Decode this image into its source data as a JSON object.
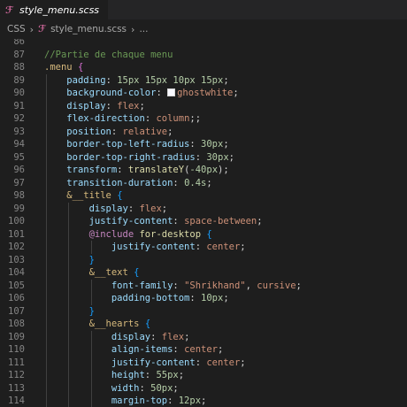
{
  "tab": {
    "label": "style_menu.scss",
    "icon": "sass-icon"
  },
  "breadcrumb": {
    "folder": "CSS",
    "file": "style_menu.scss",
    "more": "..."
  },
  "colors": {
    "editor_bg": "#1e1e1e",
    "comment": "#6a9955",
    "selector": "#d7ba7d",
    "property": "#9cdcfe",
    "string_value": "#ce9178",
    "number": "#b5cea8",
    "function": "#dcdcaa",
    "at_rule": "#c586c0",
    "brace_level1": "#da70d6",
    "brace_level2": "#179fff",
    "swatch_ghostwhite": "#f8f8ff"
  },
  "editor": {
    "lines": [
      {
        "n": "86",
        "tokens": []
      },
      {
        "n": "87",
        "tokens": [
          [
            "c-comment",
            "//Partie de chaque menu"
          ]
        ]
      },
      {
        "n": "88",
        "tokens": [
          [
            "c-sel",
            ".menu"
          ],
          [
            "c-punc",
            " "
          ],
          [
            "c-brace",
            "{"
          ]
        ]
      },
      {
        "n": "89",
        "tokens": [
          [
            "c-punc",
            "    "
          ],
          [
            "c-prop",
            "padding"
          ],
          [
            "c-punc",
            ": "
          ],
          [
            "c-num",
            "15px 15px 10px 15px"
          ],
          [
            "c-punc",
            ";"
          ]
        ]
      },
      {
        "n": "90",
        "tokens": [
          [
            "c-punc",
            "    "
          ],
          [
            "c-prop",
            "background-color"
          ],
          [
            "c-punc",
            ": "
          ],
          [
            "swatch",
            ""
          ],
          [
            "c-val",
            "ghostwhite"
          ],
          [
            "c-punc",
            ";"
          ]
        ]
      },
      {
        "n": "91",
        "tokens": [
          [
            "c-punc",
            "    "
          ],
          [
            "c-prop",
            "display"
          ],
          [
            "c-punc",
            ": "
          ],
          [
            "c-val",
            "flex"
          ],
          [
            "c-punc",
            ";"
          ]
        ]
      },
      {
        "n": "92",
        "tokens": [
          [
            "c-punc",
            "    "
          ],
          [
            "c-prop",
            "flex-direction"
          ],
          [
            "c-punc",
            ": "
          ],
          [
            "c-val",
            "column"
          ],
          [
            "c-punc",
            ";;"
          ]
        ]
      },
      {
        "n": "93",
        "tokens": [
          [
            "c-punc",
            "    "
          ],
          [
            "c-prop",
            "position"
          ],
          [
            "c-punc",
            ": "
          ],
          [
            "c-val",
            "relative"
          ],
          [
            "c-punc",
            ";"
          ]
        ]
      },
      {
        "n": "94",
        "tokens": [
          [
            "c-punc",
            "    "
          ],
          [
            "c-prop",
            "border-top-left-radius"
          ],
          [
            "c-punc",
            ": "
          ],
          [
            "c-num",
            "30px"
          ],
          [
            "c-punc",
            ";"
          ]
        ]
      },
      {
        "n": "95",
        "tokens": [
          [
            "c-punc",
            "    "
          ],
          [
            "c-prop",
            "border-top-right-radius"
          ],
          [
            "c-punc",
            ": "
          ],
          [
            "c-num",
            "30px"
          ],
          [
            "c-punc",
            ";"
          ]
        ]
      },
      {
        "n": "96",
        "tokens": [
          [
            "c-punc",
            "    "
          ],
          [
            "c-prop",
            "transform"
          ],
          [
            "c-punc",
            ": "
          ],
          [
            "c-fn",
            "translateY"
          ],
          [
            "c-punc",
            "("
          ],
          [
            "c-num",
            "-40px"
          ],
          [
            "c-punc",
            ");"
          ]
        ]
      },
      {
        "n": "97",
        "tokens": [
          [
            "c-punc",
            "    "
          ],
          [
            "c-prop",
            "transition-duration"
          ],
          [
            "c-punc",
            ": "
          ],
          [
            "c-num",
            "0.4s"
          ],
          [
            "c-punc",
            ";"
          ]
        ]
      },
      {
        "n": "98",
        "tokens": [
          [
            "c-punc",
            "    "
          ],
          [
            "c-sel",
            "&__title"
          ],
          [
            "c-punc",
            " "
          ],
          [
            "c-brace2",
            "{"
          ]
        ]
      },
      {
        "n": "99",
        "tokens": [
          [
            "c-punc",
            "        "
          ],
          [
            "c-prop",
            "display"
          ],
          [
            "c-punc",
            ": "
          ],
          [
            "c-val",
            "flex"
          ],
          [
            "c-punc",
            ";"
          ]
        ]
      },
      {
        "n": "100",
        "tokens": [
          [
            "c-punc",
            "        "
          ],
          [
            "c-prop",
            "justify-content"
          ],
          [
            "c-punc",
            ": "
          ],
          [
            "c-val",
            "space-between"
          ],
          [
            "c-punc",
            ";"
          ]
        ]
      },
      {
        "n": "101",
        "tokens": [
          [
            "c-punc",
            "        "
          ],
          [
            "c-kw",
            "@include"
          ],
          [
            "c-punc",
            " "
          ],
          [
            "c-mixin",
            "for-desktop"
          ],
          [
            "c-punc",
            " "
          ],
          [
            "c-brace2",
            "{"
          ]
        ]
      },
      {
        "n": "102",
        "tokens": [
          [
            "c-punc",
            "            "
          ],
          [
            "c-prop",
            "justify-content"
          ],
          [
            "c-punc",
            ": "
          ],
          [
            "c-val",
            "center"
          ],
          [
            "c-punc",
            ";"
          ]
        ]
      },
      {
        "n": "103",
        "tokens": [
          [
            "c-punc",
            "        "
          ],
          [
            "c-brace2",
            "}"
          ]
        ]
      },
      {
        "n": "104",
        "tokens": [
          [
            "c-punc",
            "        "
          ],
          [
            "c-sel",
            "&__text"
          ],
          [
            "c-punc",
            " "
          ],
          [
            "c-brace2",
            "{"
          ]
        ]
      },
      {
        "n": "105",
        "tokens": [
          [
            "c-punc",
            "            "
          ],
          [
            "c-prop",
            "font-family"
          ],
          [
            "c-punc",
            ": "
          ],
          [
            "c-val",
            "\"Shrikhand\""
          ],
          [
            "c-punc",
            ", "
          ],
          [
            "c-val",
            "cursive"
          ],
          [
            "c-punc",
            ";"
          ]
        ]
      },
      {
        "n": "106",
        "tokens": [
          [
            "c-punc",
            "            "
          ],
          [
            "c-prop",
            "padding-bottom"
          ],
          [
            "c-punc",
            ": "
          ],
          [
            "c-num",
            "10px"
          ],
          [
            "c-punc",
            ";"
          ]
        ]
      },
      {
        "n": "107",
        "tokens": [
          [
            "c-punc",
            "        "
          ],
          [
            "c-brace2",
            "}"
          ]
        ]
      },
      {
        "n": "108",
        "tokens": [
          [
            "c-punc",
            "        "
          ],
          [
            "c-sel",
            "&__hearts"
          ],
          [
            "c-punc",
            " "
          ],
          [
            "c-brace2",
            "{"
          ]
        ]
      },
      {
        "n": "109",
        "tokens": [
          [
            "c-punc",
            "            "
          ],
          [
            "c-prop",
            "display"
          ],
          [
            "c-punc",
            ": "
          ],
          [
            "c-val",
            "flex"
          ],
          [
            "c-punc",
            ";"
          ]
        ]
      },
      {
        "n": "110",
        "tokens": [
          [
            "c-punc",
            "            "
          ],
          [
            "c-prop",
            "align-items"
          ],
          [
            "c-punc",
            ": "
          ],
          [
            "c-val",
            "center"
          ],
          [
            "c-punc",
            ";"
          ]
        ]
      },
      {
        "n": "111",
        "tokens": [
          [
            "c-punc",
            "            "
          ],
          [
            "c-prop",
            "justify-content"
          ],
          [
            "c-punc",
            ": "
          ],
          [
            "c-val",
            "center"
          ],
          [
            "c-punc",
            ";"
          ]
        ]
      },
      {
        "n": "112",
        "tokens": [
          [
            "c-punc",
            "            "
          ],
          [
            "c-prop",
            "height"
          ],
          [
            "c-punc",
            ": "
          ],
          [
            "c-num",
            "55px"
          ],
          [
            "c-punc",
            ";"
          ]
        ]
      },
      {
        "n": "113",
        "tokens": [
          [
            "c-punc",
            "            "
          ],
          [
            "c-prop",
            "width"
          ],
          [
            "c-punc",
            ": "
          ],
          [
            "c-num",
            "50px"
          ],
          [
            "c-punc",
            ";"
          ]
        ]
      },
      {
        "n": "114",
        "tokens": [
          [
            "c-punc",
            "            "
          ],
          [
            "c-prop",
            "margin-top"
          ],
          [
            "c-punc",
            ": "
          ],
          [
            "c-num",
            "12px"
          ],
          [
            "c-punc",
            ";"
          ]
        ]
      }
    ]
  }
}
